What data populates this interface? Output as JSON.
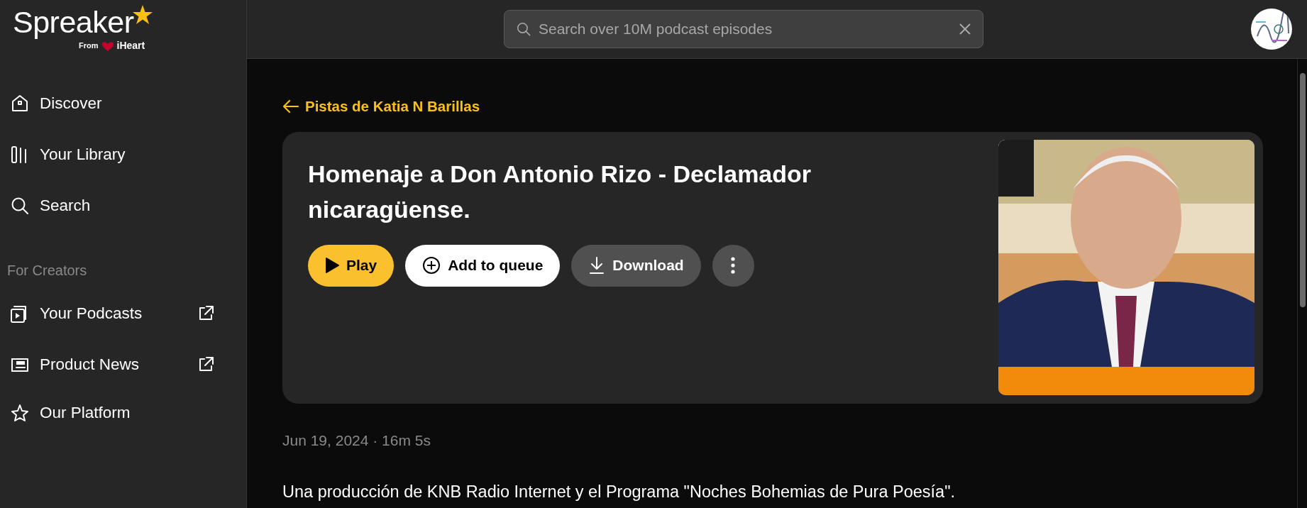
{
  "brand": {
    "name": "Spreaker",
    "from": "From",
    "partner": "iHeart"
  },
  "search": {
    "placeholder": "Search over 10M podcast episodes"
  },
  "sidebar": {
    "items": [
      {
        "label": "Discover",
        "external": false
      },
      {
        "label": "Your Library",
        "external": false
      },
      {
        "label": "Search",
        "external": false
      }
    ],
    "section_title": "For Creators",
    "creator_items": [
      {
        "label": "Your Podcasts",
        "external": true
      },
      {
        "label": "Product News",
        "external": true
      },
      {
        "label": "Our Platform",
        "external": false
      }
    ]
  },
  "back_link": "Pistas de Katia N Barillas",
  "episode": {
    "title": "Homenaje a Don Antonio Rizo - Declamador nicaragüense.",
    "buttons": [
      {
        "kind": "play",
        "label": "Play"
      },
      {
        "kind": "queue",
        "label": "Add to queue"
      },
      {
        "kind": "download",
        "label": "Download"
      },
      {
        "kind": "more"
      }
    ],
    "meta": "Jun 19, 2024 · 16m 5s",
    "description": "Una producción de KNB Radio Internet y el Programa \"Noches Bohemias de Pura Poesía\"."
  }
}
